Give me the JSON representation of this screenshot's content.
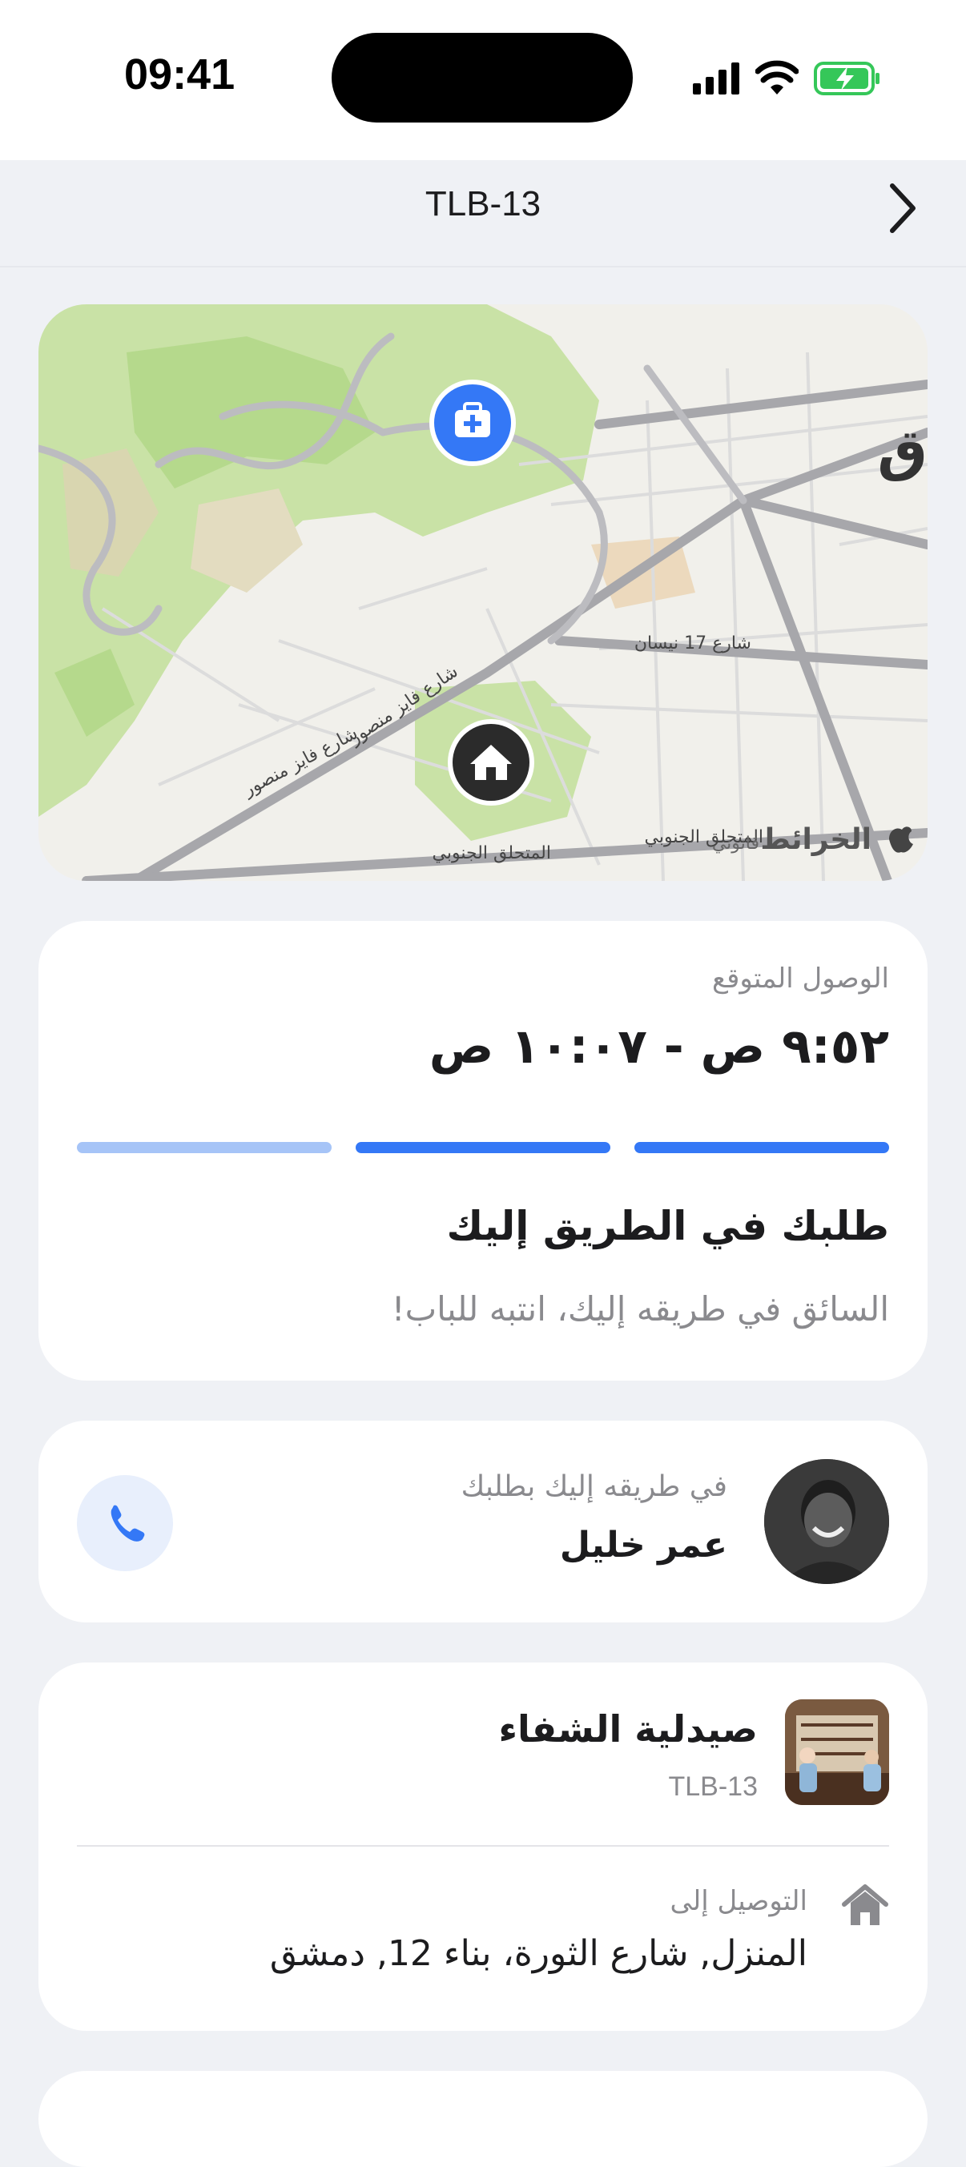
{
  "status_bar": {
    "time": "09:41"
  },
  "nav": {
    "title": "TLB-13"
  },
  "map": {
    "labels": {
      "street_17_nisan": "شارع 17 نيسان",
      "faiz_mansour_1": "شارع فايز منصور",
      "faiz_mansour_2": "شارع فايز منصور",
      "south_bypass_1": "المتحلق الجنوبي",
      "south_bypass_2": "المتحلق الجنوبي",
      "city_edge": "ق"
    },
    "attribution": "الخرائط",
    "legal": "قانوني"
  },
  "eta": {
    "label": "الوصول المتوقع",
    "value": "٩:٥٢ ص - ١٠:٠٧ ص",
    "progress_steps_total": 3,
    "progress_steps_complete": 2
  },
  "status": {
    "title": "طلبك في الطريق إليك",
    "subtitle": "السائق في طريقه إليك، انتبه للباب!"
  },
  "driver": {
    "subtitle": "في طريقه إليك بطلبك",
    "name": "عمر خليل"
  },
  "order": {
    "store_name": "صيدلية الشفاء",
    "order_code": "TLB-13",
    "delivery_label": "التوصيل إلى",
    "delivery_address": "المنزل, شارع الثورة، بناء 12, دمشق"
  },
  "colors": {
    "accent": "#3478f6",
    "accent_light": "#a6c4f7",
    "background": "#eff1f5",
    "card": "#ffffff",
    "secondary_text": "#8a8a8e"
  }
}
